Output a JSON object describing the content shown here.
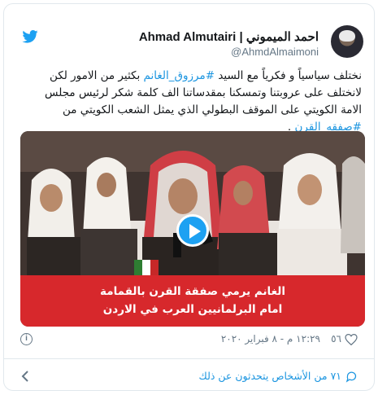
{
  "tweet": {
    "author_name": "Ahmad Almutairi | احمد الميموني",
    "handle": "@AhmdAlmaimoni",
    "text_before": "نختلف سياسياً و فكرياً مع السيد ",
    "hashtag1": "#مرزوق_الغانم",
    "text_middle": " بكثير من الامور لكن لانختلف على عروبتنا وتمسكنا بمقدساتنا الف كلمة شكر لرئيس مجلس الامة الكويتي على الموقف البطولي الذي يمثل الشعب الكويتي من ",
    "hashtag2": "#صفقه_القرن",
    "text_after": " .",
    "video_caption_line1": "الغانم يرمي صفقة القرن بالقمامة",
    "video_caption_line2": "امام البرلمانيين العرب في الاردن",
    "timestamp": "١٢:٢٩ م - ٨ فبراير ٢٠٢٠",
    "likes": "٥٦",
    "info_symbol": "i",
    "people_talking": "٧١ من الأشخاص يتحدثون عن ذلك"
  },
  "colors": {
    "link": "#1b95e0",
    "twitter_blue": "#1da1f2",
    "caption_red": "#d7282c",
    "muted": "#657786",
    "border": "#e1e8ed"
  },
  "icons": [
    "twitter-bird-icon",
    "play-icon",
    "info-icon",
    "heart-icon",
    "reply-bubble-icon",
    "chevron-left-icon"
  ]
}
